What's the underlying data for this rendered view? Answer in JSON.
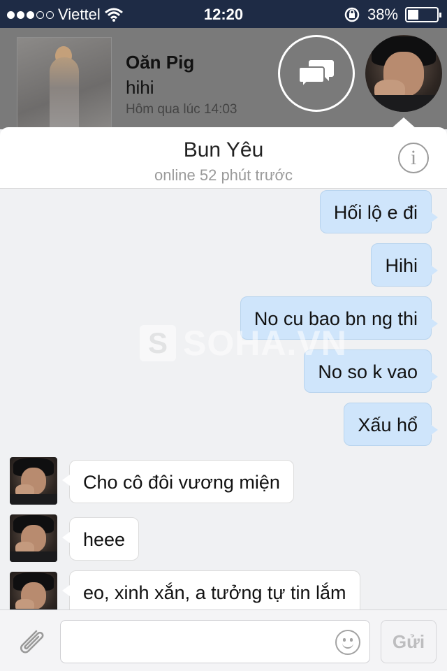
{
  "status_bar": {
    "carrier": "Viettel",
    "time": "12:20",
    "battery": "38%",
    "battery_level": 0.38,
    "signal_bars_filled": 3,
    "signal_bars_total": 5,
    "icons": [
      "wifi-icon",
      "orientation-lock-icon",
      "battery-icon"
    ]
  },
  "chat_head": {
    "name": "Oăn Pig",
    "last_message": "hihi",
    "timestamp": "Hôm qua lúc 14:03",
    "icons": [
      "chat-bubbles-icon"
    ]
  },
  "conversation": {
    "title": "Bun Yêu",
    "subtitle": "online 52 phút trước",
    "info_icon": "info-icon"
  },
  "messages": [
    {
      "direction": "out",
      "text": "Hối lộ e đi"
    },
    {
      "direction": "out",
      "text": "Hihi"
    },
    {
      "direction": "out",
      "text": "No cu bao bn ng thi"
    },
    {
      "direction": "out",
      "text": "No so k vao"
    },
    {
      "direction": "out",
      "text": "Xấu hổ"
    },
    {
      "direction": "in",
      "text": "Cho cô đôi vương miện"
    },
    {
      "direction": "in",
      "text": "heee"
    },
    {
      "direction": "in",
      "text": "eo, xinh xắn, a tưởng tự tin lắm"
    }
  ],
  "watermark": {
    "mark": "S",
    "text": "SOHA.VN"
  },
  "composer": {
    "placeholder": "",
    "send_label": "Gửi",
    "icons": [
      "paperclip-icon",
      "smiley-icon"
    ]
  },
  "colors": {
    "status_bar_bg": "#1e2b45",
    "outgoing_bubble": "#cfe5fb",
    "incoming_bubble": "#ffffff",
    "chat_bg": "#f0f1f3"
  }
}
